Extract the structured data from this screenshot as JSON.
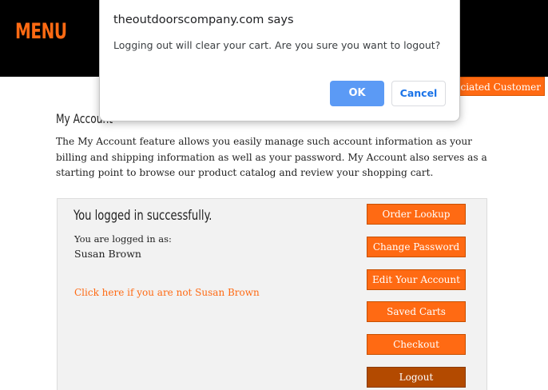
{
  "header": {
    "menu_label": "MENU",
    "associated_customer_label": "sociated Customer"
  },
  "main": {
    "page_title": "My Account",
    "intro_text": "The My Account feature allows you easily manage such account information as your billing and shipping information as well as your password. My Account also serves as a starting point to browse our product catalog and review your shopping cart.",
    "panel": {
      "success_message": "You logged in successfully.",
      "logged_in_as_label": "You are logged in as:",
      "user_name": "Susan Brown",
      "not_user_link": "Click here if you are not Susan Brown",
      "buttons": [
        {
          "label": "Order Lookup"
        },
        {
          "label": "Change Password"
        },
        {
          "label": "Edit Your Account"
        },
        {
          "label": "Saved Carts"
        },
        {
          "label": "Checkout"
        },
        {
          "label": "Logout"
        }
      ]
    }
  },
  "dialog": {
    "title": "theoutdoorscompany.com says",
    "message": "Logging out will clear your cart.  Are you sure you want to logout?",
    "ok_label": "OK",
    "cancel_label": "Cancel"
  },
  "colors": {
    "accent": "#ff6a13",
    "logout_button": "#b34a00",
    "dialog_ok": "#5b9af5",
    "dialog_cancel_text": "#1a73e8"
  }
}
